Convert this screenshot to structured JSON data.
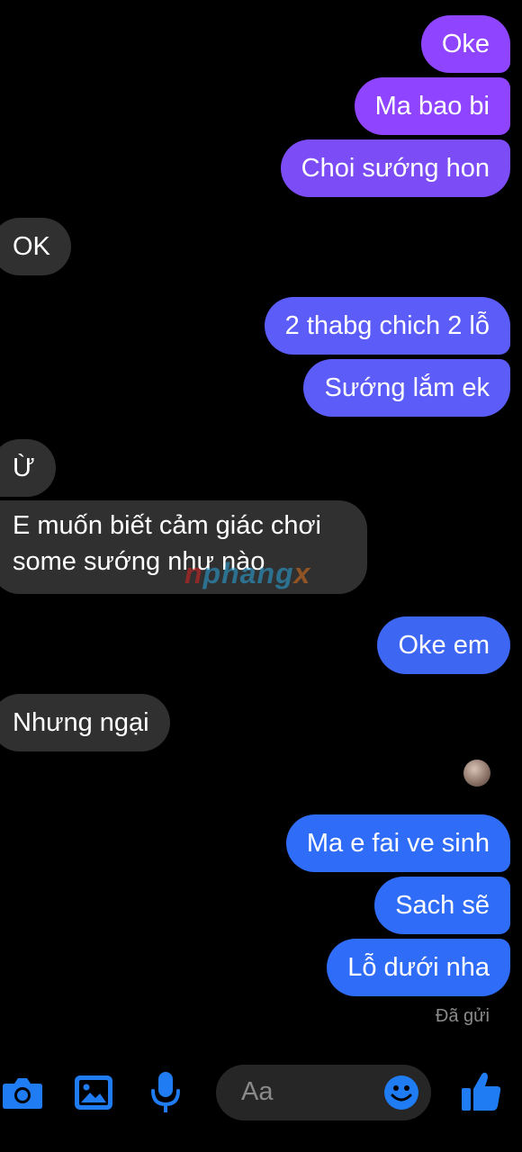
{
  "messages": [
    {
      "text": "Oke",
      "side": "outgoing"
    },
    {
      "text": "Ma bao bi",
      "side": "outgoing"
    },
    {
      "text": "Choi sướng hon",
      "side": "outgoing"
    },
    {
      "text": "OK",
      "side": "incoming"
    },
    {
      "text": "2 thabg chich 2 lỗ",
      "side": "outgoing"
    },
    {
      "text": "Sướng lắm ek",
      "side": "outgoing"
    },
    {
      "text": "Ừ",
      "side": "incoming"
    },
    {
      "text": "E muốn biết cảm giác chơi some sướng như nào",
      "side": "incoming"
    },
    {
      "text": "Oke em",
      "side": "outgoing"
    },
    {
      "text": "Nhưng ngại",
      "side": "incoming"
    },
    {
      "text": "Ma e fai ve sinh",
      "side": "outgoing"
    },
    {
      "text": "Sach sẽ",
      "side": "outgoing"
    },
    {
      "text": "Lỗ dưới nha",
      "side": "outgoing"
    }
  ],
  "watermark": {
    "part1": "n",
    "part2": "phang",
    "part3": "x"
  },
  "status": "Đã gửi",
  "composer": {
    "placeholder": "Aa",
    "icons": [
      "camera-icon",
      "image-icon",
      "microphone-icon",
      "emoji-icon",
      "thumbs-up-icon"
    ]
  },
  "colors": {
    "background": "#000000",
    "incoming_bubble": "#303030",
    "outgoing_purple": "#8f45ff",
    "outgoing_blue": "#2f6cf7",
    "composer_accent": "#1f7cf2"
  }
}
